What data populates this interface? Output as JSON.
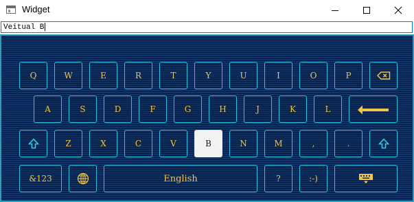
{
  "window": {
    "title": "Widget",
    "controls": {
      "minimize": "minimize",
      "maximize": "maximize",
      "close": "close"
    }
  },
  "input": {
    "value": "Veitual B"
  },
  "keyboard": {
    "colors": {
      "background": "#0b2a5b",
      "key_border": "#27c4e4",
      "key_text": "#f4c542",
      "active_key_bg": "#f3f3f3"
    },
    "row1": [
      "Q",
      "W",
      "E",
      "R",
      "T",
      "Y",
      "U",
      "I",
      "O",
      "P"
    ],
    "row1_backspace_icon": "backspace-icon",
    "row2": [
      "A",
      "S",
      "D",
      "F",
      "G",
      "H",
      "J",
      "K",
      "L"
    ],
    "row2_enter_icon": "enter-icon",
    "row3": [
      "Z",
      "X",
      "C",
      "V",
      "B",
      "N",
      "M",
      ",",
      "."
    ],
    "row3_active": "B",
    "row3_shift_icon": "shift-icon",
    "row4": {
      "symbols": "&123",
      "globe_icon": "globe-icon",
      "space_label": "English",
      "question": "?",
      "smiley": ":-)",
      "hide_icon": "keyboard-hide-icon"
    }
  }
}
